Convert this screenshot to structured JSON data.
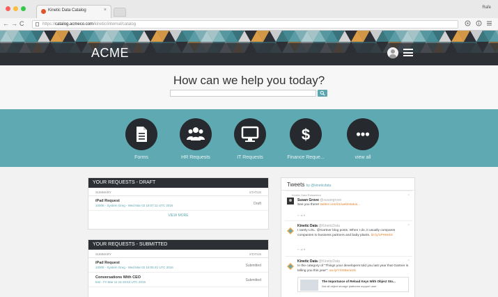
{
  "browser": {
    "tab_title": "Kinetic Data Catalog",
    "tab_close": "×",
    "user_label": "Rafe",
    "url_scheme": "https://",
    "url_host": "catalog.acmeco.com",
    "url_path": "/kinetic/internal/catalog",
    "nav_back": "←",
    "nav_forward": "→",
    "nav_reload": "C"
  },
  "header": {
    "brand": "ACME",
    "accent_color": "#5fa9b2",
    "dark_color": "#2d3036"
  },
  "help": {
    "title": "How can we help you today?",
    "search_value": ""
  },
  "categories": [
    {
      "label": "Forms",
      "icon": "document-icon"
    },
    {
      "label": "HR Requests",
      "icon": "people-icon"
    },
    {
      "label": "IT Requests",
      "icon": "monitor-icon"
    },
    {
      "label": "Finance Reque...",
      "icon": "dollar-icon"
    },
    {
      "label": "view all",
      "icon": "more-icon"
    }
  ],
  "draft": {
    "title": "YOUR REQUESTS - DRAFT",
    "col_summary": "SUMMARY",
    "col_status": "STATUS",
    "rows": [
      {
        "title": "iPad Request",
        "meta": "10006 - System Greg - Wed Mar 02 18:07:11 UTC 2016",
        "status": "Draft"
      }
    ],
    "view_more": "VIEW MORE"
  },
  "submitted": {
    "title": "YOUR REQUESTS - SUBMITTED",
    "col_summary": "SUMMARY",
    "col_status": "STATUS",
    "rows": [
      {
        "title": "iPad Request",
        "meta": "10005 - System Greg - Wed Mar 02 18:05:41 UTC 2016",
        "status": "Submitted"
      },
      {
        "title": "Conversations With CEO",
        "meta": "test - Fri Mar 11 15:19:53 UTC 2016",
        "status": "Submitted"
      }
    ]
  },
  "tweets": {
    "title": "Tweets",
    "by": "by @kineticdata",
    "items": [
      {
        "retweet": "Kinetic Data Retweeted",
        "name": "Susan Grove",
        "handle": "@susangrove",
        "text": "See you there!",
        "link": "twitter.com/i/1/web/status..."
      },
      {
        "name": "Kinetic Data",
        "handle": "@KineticData",
        "text": "I rarely LOL. @Gartner blog posts. When I do, it usually compares companies to business partners and baby plants.",
        "link": "bit.ly/1PH6HiD"
      },
      {
        "name": "Kinetic Data",
        "handle": "@KineticData",
        "text": "In the category of \"Things your developers told you last year that Gartner is telling you this year\":",
        "link": "ow.ly/YXHBe/a1rk",
        "card_title": "The Importance of Reload Keys With Object Sto...",
        "card_desc": "Not all object storage platforms support user"
      }
    ]
  }
}
